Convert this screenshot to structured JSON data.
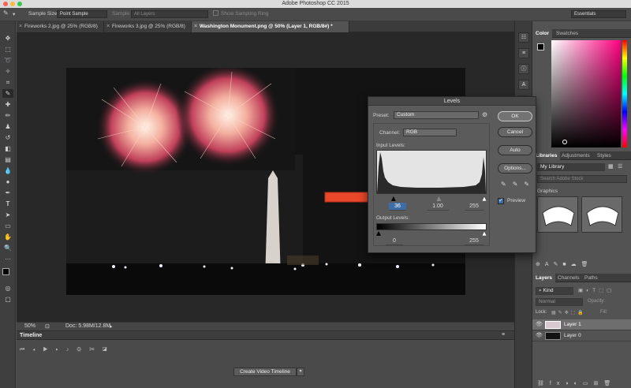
{
  "window": {
    "title": "Adobe Photoshop CC 2015"
  },
  "options": {
    "sample_size_label": "Sample Size:",
    "sample_size_value": "Point Sample",
    "sample_label": "Sample:",
    "sample_value": "All Layers",
    "show_ring_label": "Show Sampling Ring",
    "workspace_value": "Essentials"
  },
  "tabs": [
    {
      "label": "Fireworks 2.jpg @ 25% (RGB/8)"
    },
    {
      "label": "Fireworks 3.jpg @ 25% (RGB/8)"
    },
    {
      "label": "Washington Monument.png @ 50% (Layer 1, RGB/8#) *"
    }
  ],
  "status": {
    "zoom": "50%",
    "doc": "Doc: 5.98M/12.8M"
  },
  "timeline": {
    "title": "Timeline",
    "create_button": "Create Video Timeline"
  },
  "levels": {
    "title": "Levels",
    "preset_label": "Preset:",
    "preset_value": "Custom",
    "channel_label": "Channel:",
    "channel_value": "RGB",
    "input_levels_label": "Input Levels:",
    "input_black": "36",
    "input_mid": "1.00",
    "input_white": "255",
    "input_black_fraction": 0.141,
    "input_mid_fraction": 0.57,
    "output_levels_label": "Output Levels:",
    "output_black": "0",
    "output_white": "255",
    "ok_label": "OK",
    "cancel_label": "Cancel",
    "auto_label": "Auto",
    "options_label": "Options...",
    "preview_label": "Preview",
    "preview_checked": true
  },
  "panels": {
    "color_tab": "Color",
    "swatches_tab": "Swatches",
    "libraries_tab": "Libraries",
    "adjustments_tab": "Adjustments",
    "styles_tab": "Styles",
    "library_select": "My Library",
    "search_placeholder": "Search Adobe Stock",
    "graphics_label": "Graphics",
    "layers_tab": "Layers",
    "channels_tab": "Channels",
    "paths_tab": "Paths",
    "kind_filter": "Kind",
    "blend_mode": "Normal",
    "opacity_label": "Opacity:",
    "fill_label": "Fill:",
    "lock_label": "Lock:",
    "layers": [
      {
        "name": "Layer 1"
      },
      {
        "name": "Layer 0"
      }
    ]
  },
  "colors": {
    "accent_arrow": "#e8472a",
    "dialog_bg": "#5b5b5b",
    "canvas_bg": "#282828"
  }
}
